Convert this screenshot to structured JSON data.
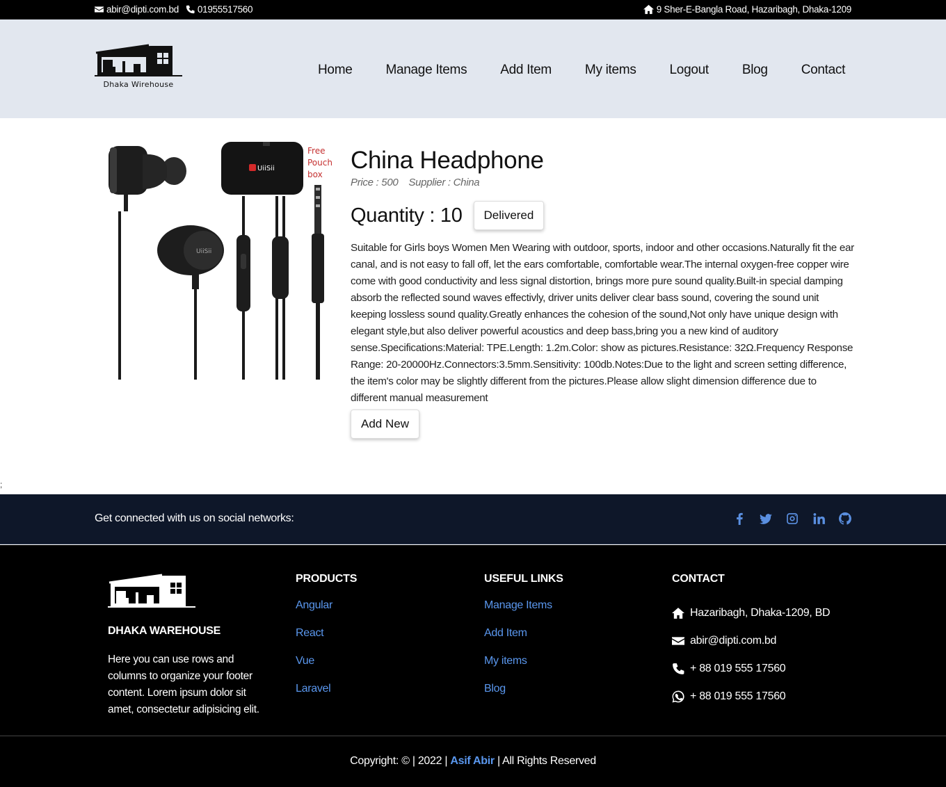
{
  "topbar": {
    "email": "abir@dipti.com.bd",
    "phone": "01955517560",
    "address": "9 Sher-E-Bangla Road, Hazaribagh, Dhaka-1209"
  },
  "header": {
    "logo_text": "Dhaka Wirehouse",
    "nav": [
      "Home",
      "Manage Items",
      "Add Item",
      "My items",
      "Logout",
      "Blog",
      "Contact"
    ]
  },
  "product": {
    "image_caption": [
      "Free",
      "Pouch",
      "box"
    ],
    "image_brand": "UiiSii",
    "title": "China Headphone",
    "price": "Price : 500",
    "supplier": "Supplier : China",
    "quantity": "Quantity : 10",
    "delivered_label": "Delivered",
    "description": "Suitable for Girls boys Women Men Wearing with outdoor, sports, indoor and other occasions.Naturally fit the ear canal, and is not easy to fall off, let the ears comfortable, comfortable wear.The internal oxygen-free copper wire come with good conductivity and less signal distortion, brings more pure sound quality.Built-in special damping absorb the reflected sound waves effectivly, driver units deliver clear bass sound, covering the sound unit keeping lossless sound quality.Greatly enhances the cohesion of the sound,Not only have unique design with elegant style,but also deliver powerful acoustics and deep bass,bring you a new kind of auditory sense.Specifications:Material: TPE.Length: 1.2m.Color: show as pictures.Resistance: 32Ω.Frequency Response Range: 20-20000Hz.Connectors:3.5mm.Sensitivity: 100db.Notes:Due to the light and screen setting difference, the item's color may be slightly different from the pictures.Please allow slight dimension difference due to different manual measurement",
    "add_new_label": "Add New"
  },
  "stray_text": ";",
  "social": {
    "text": "Get connected with us on social networks:",
    "icons": [
      "facebook-icon",
      "twitter-icon",
      "instagram-icon",
      "linkedin-icon",
      "github-icon"
    ],
    "icon_color": "#5a8fe0"
  },
  "footer": {
    "brand_name": "DHAKA WAREHOUSE",
    "brand_text": "Here you can use rows and columns to organize your footer content. Lorem ipsum dolor sit amet, consectetur adipisicing elit.",
    "products_heading": "PRODUCTS",
    "products": [
      "Angular",
      "React",
      "Vue",
      "Laravel"
    ],
    "links_heading": "USEFUL LINKS",
    "links": [
      "Manage Items",
      "Add Item",
      "My items",
      "Blog"
    ],
    "contact_heading": "CONTACT",
    "contact": {
      "address": "Hazaribagh, Dhaka-1209, BD",
      "email": "abir@dipti.com.bd",
      "phone": "+ 88 019 555 17560",
      "whatsapp": "+ 88 019 555 17560"
    },
    "copyright_prefix": "Copyright: © | 2022 |",
    "copyright_author": "Asif Abir",
    "copyright_suffix": "| All Rights Reserved",
    "link_color": "#5a97ee"
  }
}
